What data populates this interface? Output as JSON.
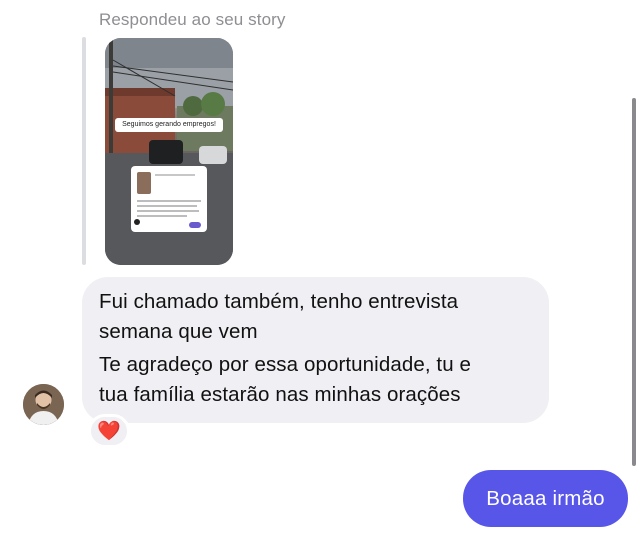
{
  "story_reply": {
    "caption": "Respondeu ao seu story",
    "thumbnail_banner": "Seguimos gerando empregos!"
  },
  "received_message": {
    "lines": [
      "Fui chamado também, tenho entrevista",
      "semana que vem",
      "Te agradeço por essa oportunidade, tu e",
      "tua família estarão nas minhas orações"
    ],
    "reaction": "❤️"
  },
  "sent_message": {
    "text": "Boaaa irmão"
  },
  "colors": {
    "sent_bubble": "#5856e8",
    "received_bubble": "#efeff4",
    "caption_gray": "#8e8e93"
  }
}
